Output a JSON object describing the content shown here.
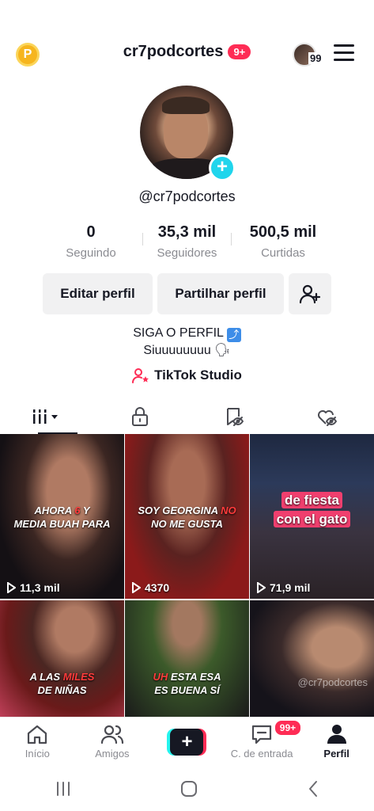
{
  "header": {
    "points_icon_letter": "P",
    "username": "cr7podcortes",
    "notifications_badge": "9+",
    "account_switch_count": "99"
  },
  "profile": {
    "handle": "@cr7podcortes",
    "stats": [
      {
        "value": "0",
        "label": "Seguindo"
      },
      {
        "value": "35,3 mil",
        "label": "Seguidores"
      },
      {
        "value": "500,5 mil",
        "label": "Curtidas"
      }
    ],
    "edit_button": "Editar perfil",
    "share_button": "Partilhar perfil",
    "bio_line1": "SIGA O PERFIL",
    "bio_line1_emoji": "⤴",
    "bio_line2": "Siuuuuuuuu 🗣",
    "studio_label": "TikTok Studio"
  },
  "tabs": [
    {
      "name": "videos",
      "icon": "grid-bars-icon",
      "active": true
    },
    {
      "name": "private",
      "icon": "lock-icon",
      "active": false
    },
    {
      "name": "reposts",
      "icon": "repost-hidden-icon",
      "active": false
    },
    {
      "name": "liked",
      "icon": "heart-hidden-icon",
      "active": false
    }
  ],
  "videos": [
    {
      "caption_parts": [
        "AHORA ",
        "6",
        " Y",
        "MEDIA BUAH PARA"
      ],
      "views": "11,3 mil"
    },
    {
      "caption_parts": [
        "SOY GEORGINA ",
        "NO",
        "",
        "NO ME GUSTA"
      ],
      "views": "4370"
    },
    {
      "caption_line1": "de fiesta",
      "caption_line2": "con el gato",
      "views": "71,9 mil"
    },
    {
      "caption_parts": [
        "A LAS ",
        "MILES",
        "",
        "DE NIÑAS"
      ]
    },
    {
      "caption_parts": [
        "",
        "UH",
        " ESTA ESA",
        "ES BUENA SÍ"
      ]
    },
    {
      "watermark": "@cr7podcortes"
    }
  ],
  "bottom_nav": {
    "home": "Início",
    "friends": "Amigos",
    "inbox": "C. de entrada",
    "inbox_badge": "99+",
    "profile": "Perfil"
  },
  "colors": {
    "accent_red": "#fe2c55",
    "accent_cyan": "#20d5ec",
    "text": "#161823",
    "muted": "#8a8b91"
  }
}
